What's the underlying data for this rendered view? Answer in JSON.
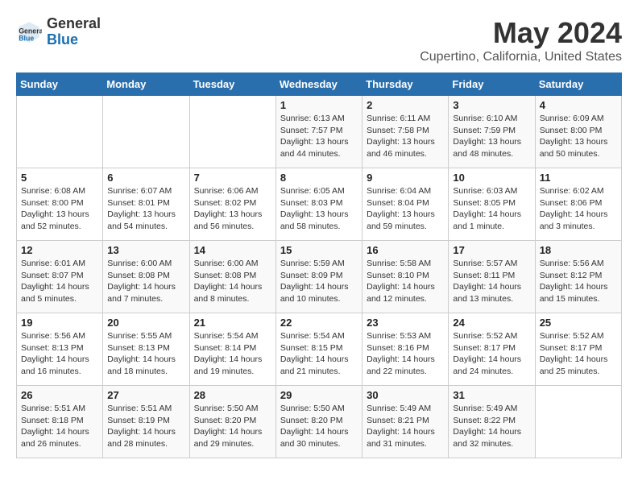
{
  "header": {
    "logo_general": "General",
    "logo_blue": "Blue",
    "title": "May 2024",
    "subtitle": "Cupertino, California, United States"
  },
  "weekdays": [
    "Sunday",
    "Monday",
    "Tuesday",
    "Wednesday",
    "Thursday",
    "Friday",
    "Saturday"
  ],
  "weeks": [
    [
      {
        "day": "",
        "info": ""
      },
      {
        "day": "",
        "info": ""
      },
      {
        "day": "",
        "info": ""
      },
      {
        "day": "1",
        "info": "Sunrise: 6:13 AM\nSunset: 7:57 PM\nDaylight: 13 hours\nand 44 minutes."
      },
      {
        "day": "2",
        "info": "Sunrise: 6:11 AM\nSunset: 7:58 PM\nDaylight: 13 hours\nand 46 minutes."
      },
      {
        "day": "3",
        "info": "Sunrise: 6:10 AM\nSunset: 7:59 PM\nDaylight: 13 hours\nand 48 minutes."
      },
      {
        "day": "4",
        "info": "Sunrise: 6:09 AM\nSunset: 8:00 PM\nDaylight: 13 hours\nand 50 minutes."
      }
    ],
    [
      {
        "day": "5",
        "info": "Sunrise: 6:08 AM\nSunset: 8:00 PM\nDaylight: 13 hours\nand 52 minutes."
      },
      {
        "day": "6",
        "info": "Sunrise: 6:07 AM\nSunset: 8:01 PM\nDaylight: 13 hours\nand 54 minutes."
      },
      {
        "day": "7",
        "info": "Sunrise: 6:06 AM\nSunset: 8:02 PM\nDaylight: 13 hours\nand 56 minutes."
      },
      {
        "day": "8",
        "info": "Sunrise: 6:05 AM\nSunset: 8:03 PM\nDaylight: 13 hours\nand 58 minutes."
      },
      {
        "day": "9",
        "info": "Sunrise: 6:04 AM\nSunset: 8:04 PM\nDaylight: 13 hours\nand 59 minutes."
      },
      {
        "day": "10",
        "info": "Sunrise: 6:03 AM\nSunset: 8:05 PM\nDaylight: 14 hours\nand 1 minute."
      },
      {
        "day": "11",
        "info": "Sunrise: 6:02 AM\nSunset: 8:06 PM\nDaylight: 14 hours\nand 3 minutes."
      }
    ],
    [
      {
        "day": "12",
        "info": "Sunrise: 6:01 AM\nSunset: 8:07 PM\nDaylight: 14 hours\nand 5 minutes."
      },
      {
        "day": "13",
        "info": "Sunrise: 6:00 AM\nSunset: 8:08 PM\nDaylight: 14 hours\nand 7 minutes."
      },
      {
        "day": "14",
        "info": "Sunrise: 6:00 AM\nSunset: 8:08 PM\nDaylight: 14 hours\nand 8 minutes."
      },
      {
        "day": "15",
        "info": "Sunrise: 5:59 AM\nSunset: 8:09 PM\nDaylight: 14 hours\nand 10 minutes."
      },
      {
        "day": "16",
        "info": "Sunrise: 5:58 AM\nSunset: 8:10 PM\nDaylight: 14 hours\nand 12 minutes."
      },
      {
        "day": "17",
        "info": "Sunrise: 5:57 AM\nSunset: 8:11 PM\nDaylight: 14 hours\nand 13 minutes."
      },
      {
        "day": "18",
        "info": "Sunrise: 5:56 AM\nSunset: 8:12 PM\nDaylight: 14 hours\nand 15 minutes."
      }
    ],
    [
      {
        "day": "19",
        "info": "Sunrise: 5:56 AM\nSunset: 8:13 PM\nDaylight: 14 hours\nand 16 minutes."
      },
      {
        "day": "20",
        "info": "Sunrise: 5:55 AM\nSunset: 8:13 PM\nDaylight: 14 hours\nand 18 minutes."
      },
      {
        "day": "21",
        "info": "Sunrise: 5:54 AM\nSunset: 8:14 PM\nDaylight: 14 hours\nand 19 minutes."
      },
      {
        "day": "22",
        "info": "Sunrise: 5:54 AM\nSunset: 8:15 PM\nDaylight: 14 hours\nand 21 minutes."
      },
      {
        "day": "23",
        "info": "Sunrise: 5:53 AM\nSunset: 8:16 PM\nDaylight: 14 hours\nand 22 minutes."
      },
      {
        "day": "24",
        "info": "Sunrise: 5:52 AM\nSunset: 8:17 PM\nDaylight: 14 hours\nand 24 minutes."
      },
      {
        "day": "25",
        "info": "Sunrise: 5:52 AM\nSunset: 8:17 PM\nDaylight: 14 hours\nand 25 minutes."
      }
    ],
    [
      {
        "day": "26",
        "info": "Sunrise: 5:51 AM\nSunset: 8:18 PM\nDaylight: 14 hours\nand 26 minutes."
      },
      {
        "day": "27",
        "info": "Sunrise: 5:51 AM\nSunset: 8:19 PM\nDaylight: 14 hours\nand 28 minutes."
      },
      {
        "day": "28",
        "info": "Sunrise: 5:50 AM\nSunset: 8:20 PM\nDaylight: 14 hours\nand 29 minutes."
      },
      {
        "day": "29",
        "info": "Sunrise: 5:50 AM\nSunset: 8:20 PM\nDaylight: 14 hours\nand 30 minutes."
      },
      {
        "day": "30",
        "info": "Sunrise: 5:49 AM\nSunset: 8:21 PM\nDaylight: 14 hours\nand 31 minutes."
      },
      {
        "day": "31",
        "info": "Sunrise: 5:49 AM\nSunset: 8:22 PM\nDaylight: 14 hours\nand 32 minutes."
      },
      {
        "day": "",
        "info": ""
      }
    ]
  ]
}
